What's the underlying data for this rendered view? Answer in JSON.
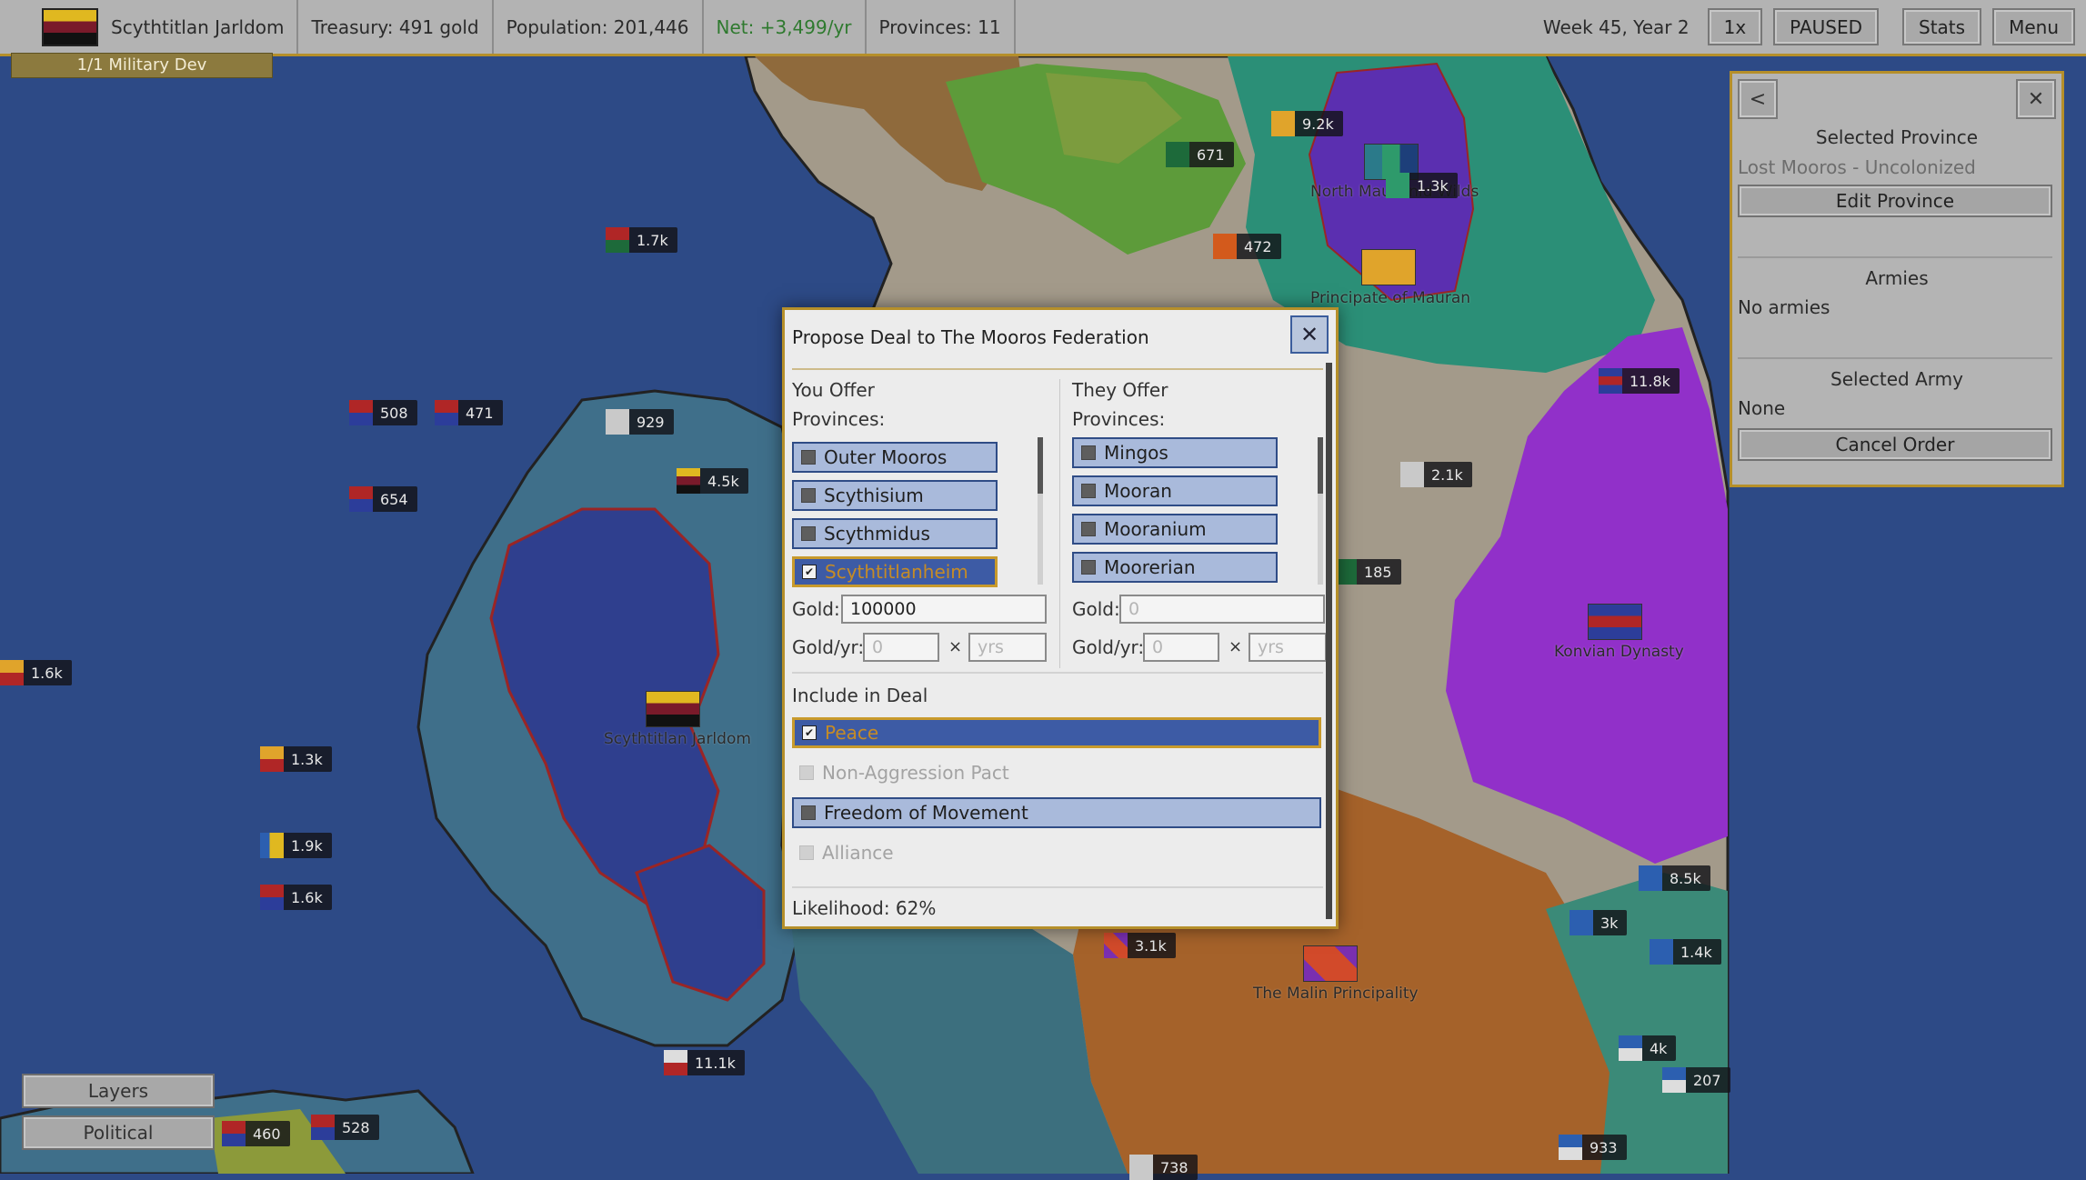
{
  "topbar": {
    "nation_name": "Scythtitlan Jarldom",
    "treasury": "Treasury: 491 gold",
    "population": "Population: 201,446",
    "net": "Net: +3,499/yr",
    "provinces": "Provinces: 11",
    "date": "Week 45, Year 2",
    "speed": "1x",
    "paused": "PAUSED",
    "stats": "Stats",
    "menu": "Menu"
  },
  "military_dev": "1/1 Military Dev",
  "map": {
    "armies": [
      "1.7k",
      "508",
      "471",
      "654",
      "929",
      "4.5k",
      "1.6k",
      "1.3k",
      "1.9k",
      "1.6k",
      "9.2k",
      "671",
      "472",
      "11.8k",
      "2.1k",
      "185",
      "3.1k",
      "8.5k",
      "3k",
      "1.4k",
      "4k",
      "207",
      "933",
      "11.1k",
      "460",
      "528",
      "738",
      "1.3k"
    ],
    "labels": {
      "north": "North Mausanid Wilds",
      "mauran": "Principate of Mauran",
      "scythtitlan": "Scythtitlan Jarldom",
      "konvian": "Konvian Dynasty",
      "malin": "The Malin Principality"
    }
  },
  "right_panel": {
    "back_icon": "<",
    "close_icon": "✕",
    "selected_province_title": "Selected Province",
    "selected_province_value": "Lost Mooros - Uncolonized",
    "edit_province": "Edit Province",
    "armies_title": "Armies",
    "armies_value": "No armies",
    "selected_army_title": "Selected Army",
    "selected_army_value": "None",
    "cancel_order": "Cancel Order"
  },
  "bottom_left": {
    "layers": "Layers",
    "political": "Political"
  },
  "dialog": {
    "title": "Propose Deal to The Mooros Federation",
    "close_icon": "✕",
    "you_offer": "You Offer",
    "they_offer": "They Offer",
    "provinces_label": "Provinces:",
    "you_provinces": [
      {
        "name": "Outer Mooros",
        "checked": false
      },
      {
        "name": "Scythisium",
        "checked": false
      },
      {
        "name": "Scythmidus",
        "checked": false
      },
      {
        "name": "Scythtitlanheim",
        "checked": true
      }
    ],
    "they_provinces": [
      {
        "name": "Mingos",
        "checked": false
      },
      {
        "name": "Mooran",
        "checked": false
      },
      {
        "name": "Mooranium",
        "checked": false
      },
      {
        "name": "Moorerian",
        "checked": false
      }
    ],
    "gold_label": "Gold:",
    "gold_yr_label": "Gold/yr:",
    "times": "×",
    "you_gold": "100000",
    "they_gold_placeholder": "0",
    "gold_yr_placeholder": "0",
    "yrs_placeholder": "yrs",
    "include_label": "Include in Deal",
    "deal_items": [
      {
        "name": "Peace",
        "state": "checked"
      },
      {
        "name": "Non-Aggression Pact",
        "state": "disabled"
      },
      {
        "name": "Freedom of Movement",
        "state": "active"
      },
      {
        "name": "Alliance",
        "state": "disabled"
      }
    ],
    "likelihood": "Likelihood: 62%"
  },
  "colors": {
    "sea": "#2d4a86",
    "accent_gold": "#b58f2a",
    "panel_gray": "#b4b4b4",
    "button_blue": "#a9badb",
    "button_blue_border": "#2f4c86",
    "net_green": "#2f7a2f"
  }
}
